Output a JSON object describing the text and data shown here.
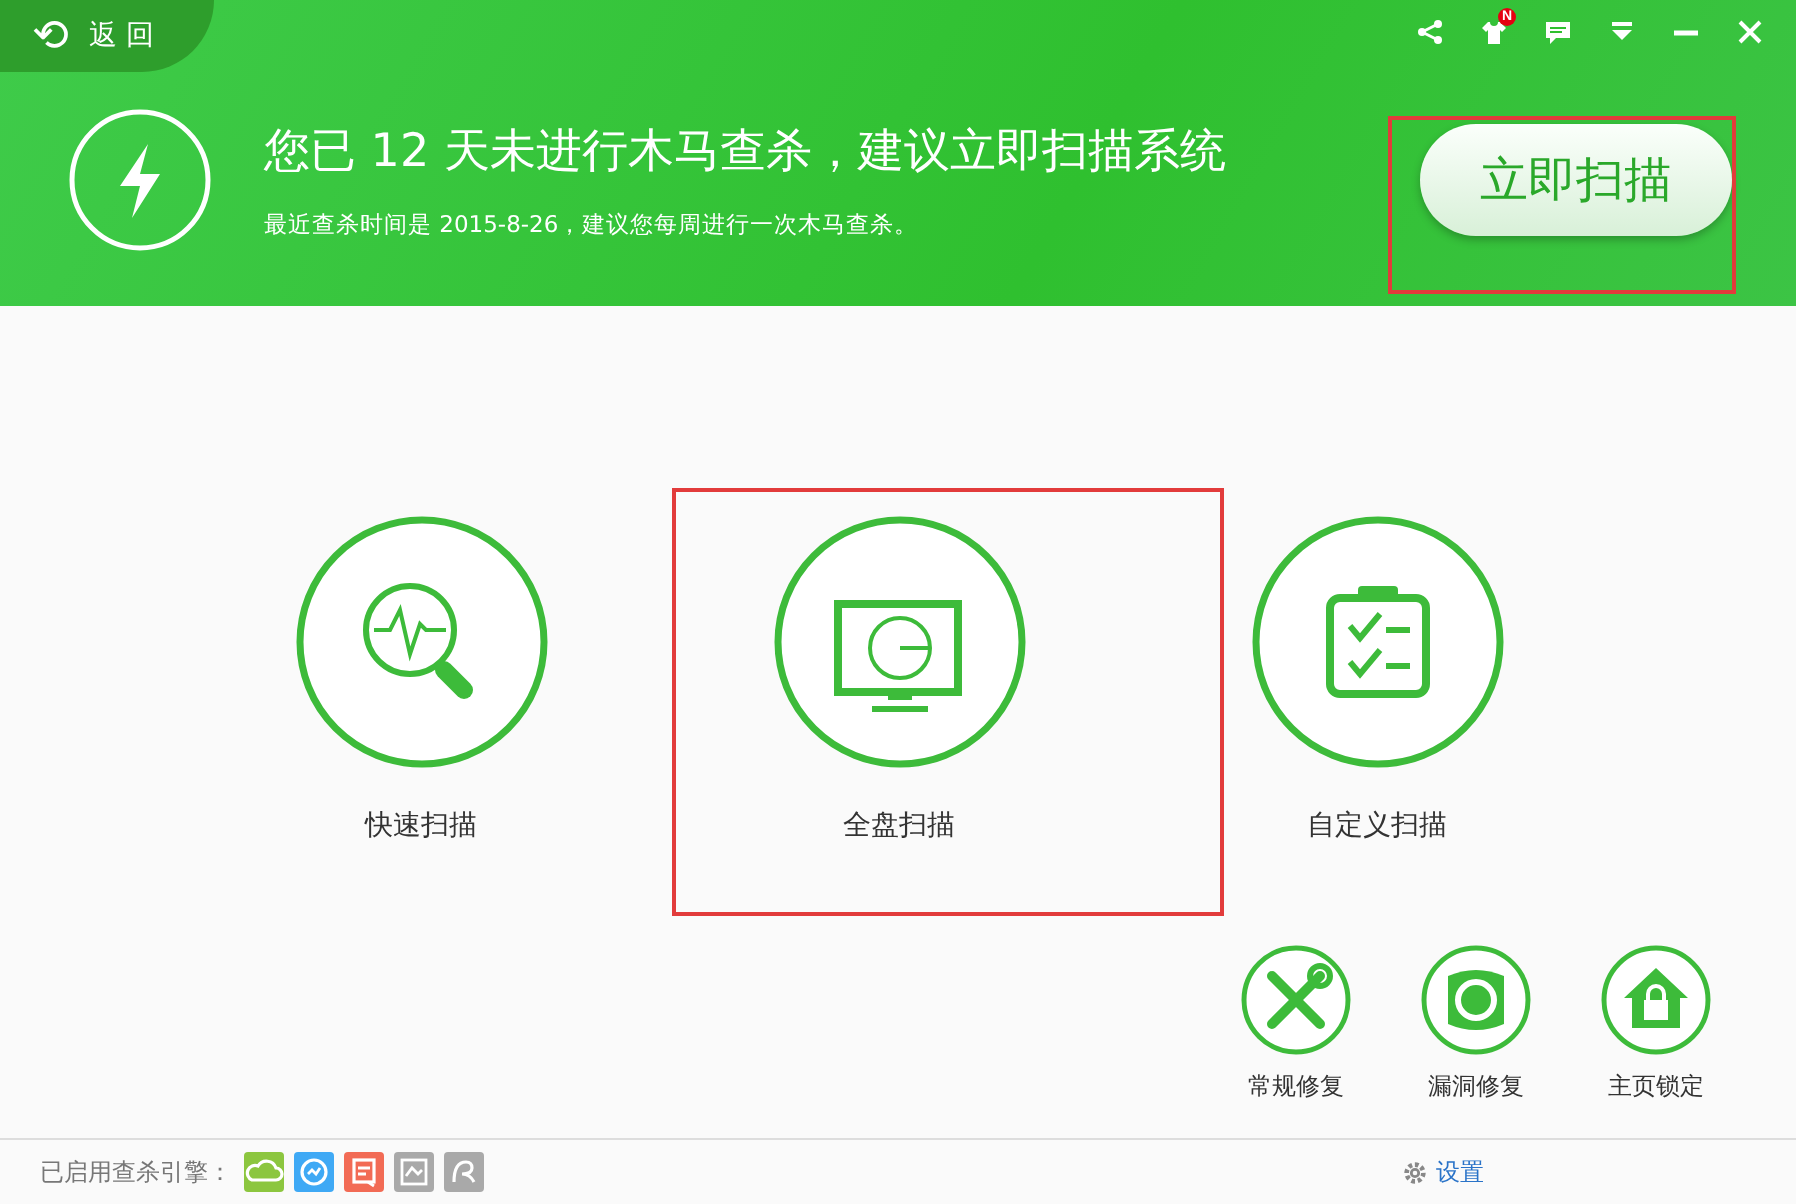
{
  "back_button": {
    "arrow": "⟲",
    "label": "返 回"
  },
  "title_bar": {
    "buttons": [
      {
        "kind": "share"
      },
      {
        "kind": "shirt",
        "badge": "N"
      },
      {
        "kind": "message"
      },
      {
        "kind": "dropdown"
      },
      {
        "kind": "minimize"
      },
      {
        "kind": "close"
      }
    ]
  },
  "banner": {
    "headline": "您已 12 天未进行木马查杀，建议立即扫描系统",
    "subtitle": "最近查杀时间是 2015-8-26，建议您每周进行一次木马查杀。",
    "scan_button": {
      "label": "立即扫描",
      "highlighted": true
    }
  },
  "scan_modes": [
    {
      "kind": "quick",
      "label": "快速扫描",
      "highlighted": false
    },
    {
      "kind": "full",
      "label": "全盘扫描",
      "highlighted": true
    },
    {
      "kind": "custom",
      "label": "自定义扫描",
      "highlighted": false
    }
  ],
  "tools": [
    {
      "kind": "repair",
      "label": "常规修复"
    },
    {
      "kind": "vulnerability",
      "label": "漏洞修复"
    },
    {
      "kind": "homepage",
      "label": "主页锁定"
    }
  ],
  "footer": {
    "engines_label": "已启用查杀引擎：",
    "engines": [
      {
        "kind": "cloud",
        "color": "#8cc63f"
      },
      {
        "kind": "check",
        "color": "#3fa9f5"
      },
      {
        "kind": "doc",
        "color": "#f26b55"
      },
      {
        "kind": "chart",
        "color": "#a9a9a9"
      },
      {
        "kind": "curve",
        "color": "#a9a9a9"
      }
    ],
    "settings_link": "设置"
  }
}
